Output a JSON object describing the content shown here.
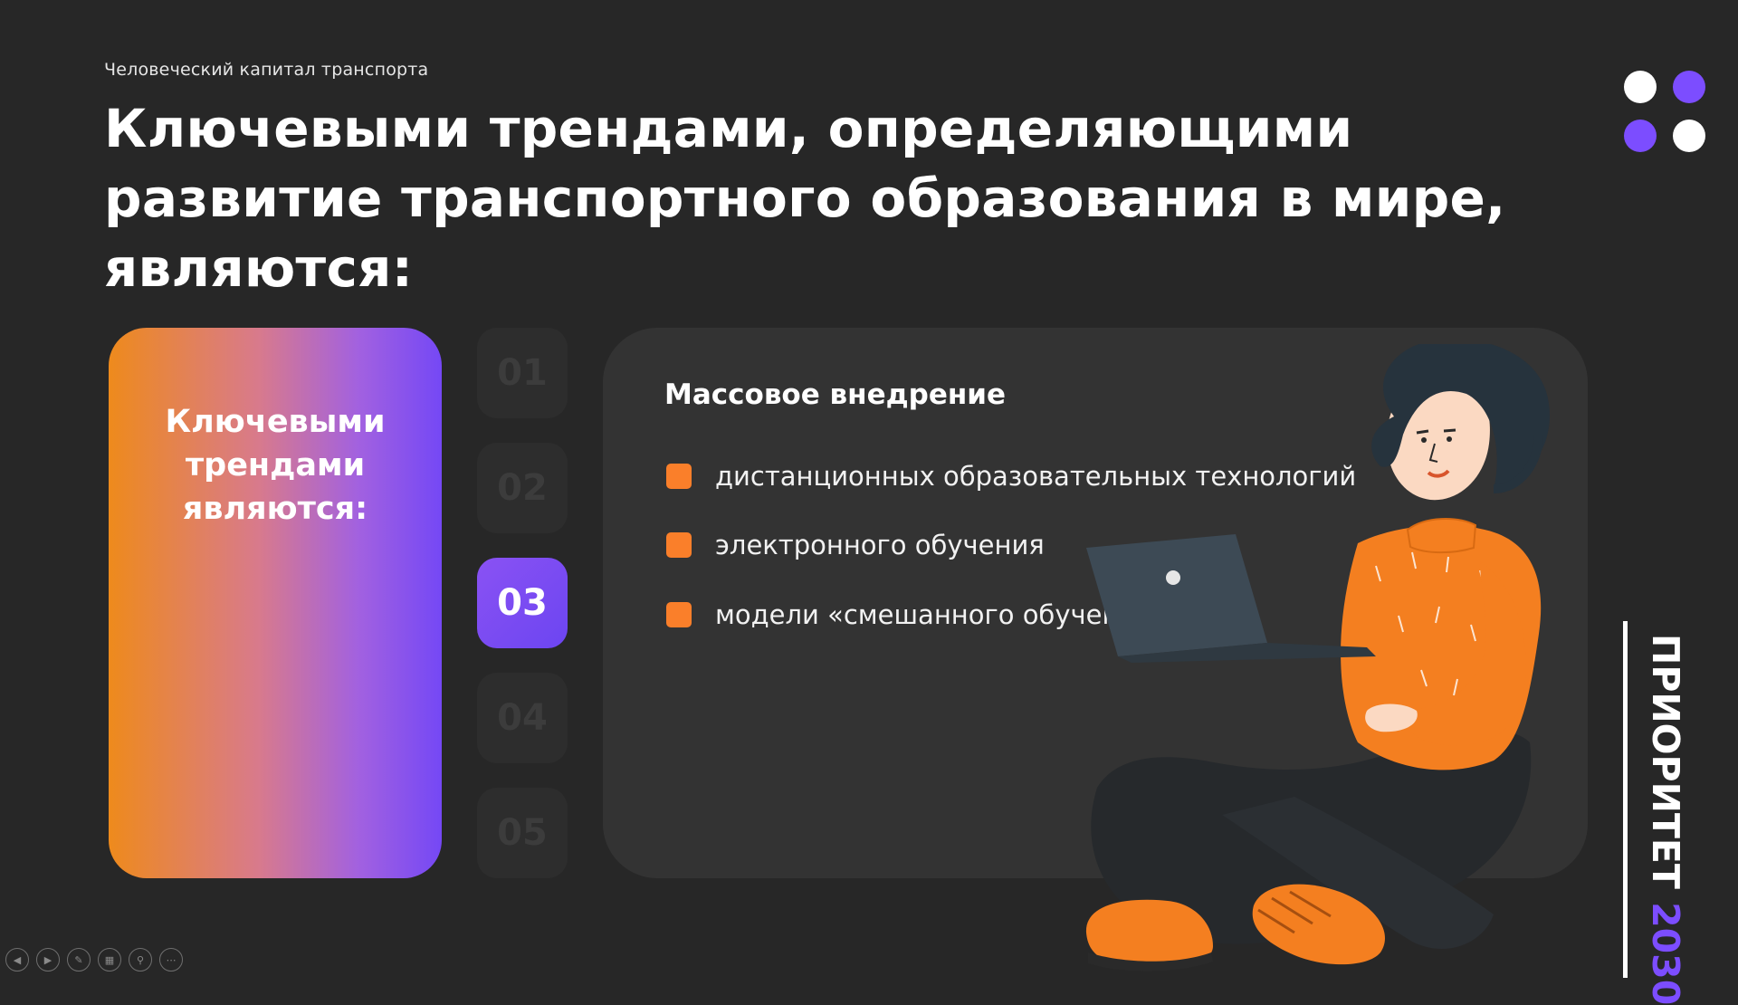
{
  "header": {
    "subtitle": "Человеческий капитал транспорта",
    "title": "Ключевыми трендами, определяющими развитие транспортного образования в мире, являются:"
  },
  "left_card": {
    "text": "Ключевыми трендами являются:"
  },
  "steps": [
    "01",
    "02",
    "03",
    "04",
    "05"
  ],
  "active_step": "03",
  "content": {
    "title": "Массовое внедрение",
    "bullets": [
      "дистанционных образовательных технологий",
      "электронного обучения",
      "модели «смешанного обучения»"
    ]
  },
  "brand": {
    "word": "ПРИОРИТЕТ",
    "year": "2030"
  },
  "colors": {
    "background": "#272727",
    "accent_violet": "#7c4dff",
    "accent_orange": "#fa7f2a",
    "card": "#333333",
    "step_inactive": "#2d2d2d"
  },
  "icons": {
    "slideshow_controls": [
      "previous-slide-icon",
      "next-slide-icon",
      "pen-icon",
      "slide-overview-icon",
      "zoom-icon",
      "more-options-icon"
    ]
  }
}
